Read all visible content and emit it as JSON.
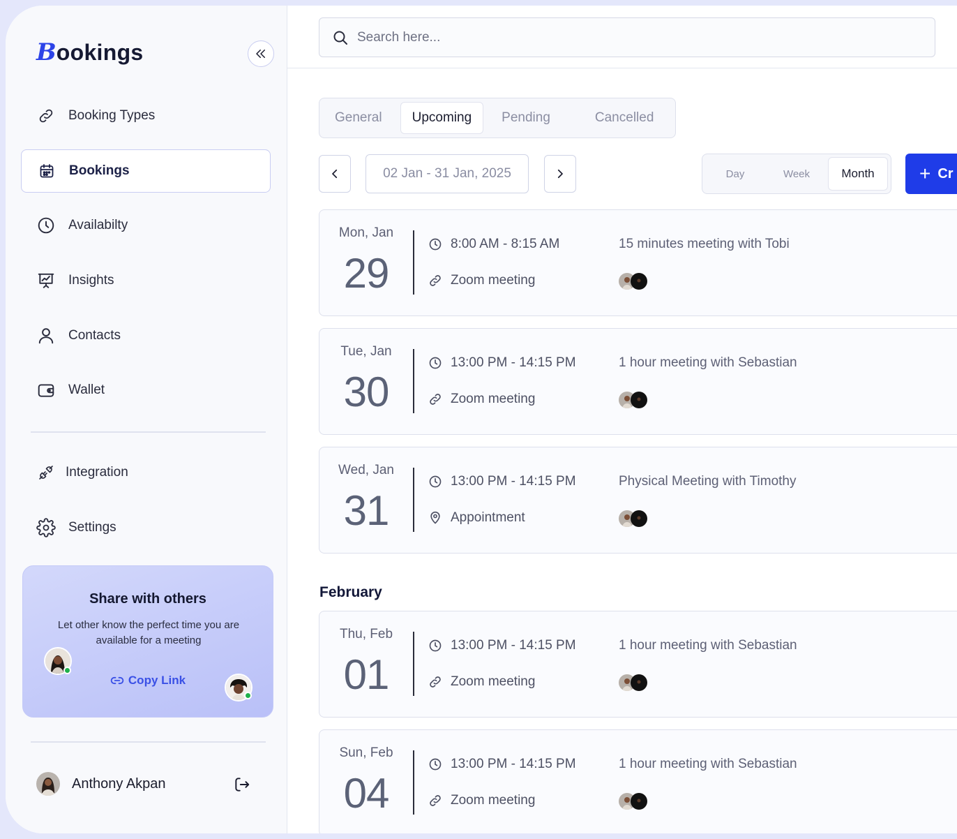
{
  "app": {
    "logo_initial": "B",
    "logo_rest": "ookings"
  },
  "sidebar": {
    "items": [
      {
        "label": "Booking Types",
        "icon": "link-icon"
      },
      {
        "label": "Bookings",
        "icon": "calendar-icon",
        "active": true
      },
      {
        "label": "Availabilty",
        "icon": "clock-icon"
      },
      {
        "label": "Insights",
        "icon": "presentation-chart-icon"
      },
      {
        "label": "Contacts",
        "icon": "user-icon"
      },
      {
        "label": "Wallet",
        "icon": "wallet-icon"
      }
    ],
    "secondary_items": [
      {
        "label": "Integration",
        "icon": "plug-icon"
      },
      {
        "label": "Settings",
        "icon": "gear-icon"
      }
    ],
    "share_card": {
      "title": "Share with others",
      "description": "Let other know the perfect time you are available for a meeting",
      "copy_link_label": "Copy Link"
    },
    "user": {
      "name": "Anthony Akpan"
    }
  },
  "search": {
    "placeholder": "Search here..."
  },
  "tabs": [
    {
      "label": "General"
    },
    {
      "label": "Upcoming",
      "active": true
    },
    {
      "label": "Pending"
    },
    {
      "label": "Cancelled"
    }
  ],
  "date_nav": {
    "range": "02 Jan - 31 Jan, 2025"
  },
  "view_toggle": [
    {
      "label": "Day"
    },
    {
      "label": "Week"
    },
    {
      "label": "Month",
      "active": true
    }
  ],
  "create_button": {
    "label": "Cr"
  },
  "events": [
    {
      "day": "Mon, Jan",
      "date": "29",
      "time": "8:00 AM - 8:15 AM",
      "location": "Zoom meeting",
      "location_icon": "link-icon",
      "title": "15 minutes meeting with Tobi"
    },
    {
      "day": "Tue, Jan",
      "date": "30",
      "time": "13:00 PM - 14:15 PM",
      "location": "Zoom meeting",
      "location_icon": "link-icon",
      "title": "1 hour meeting with Sebastian"
    },
    {
      "day": "Wed, Jan",
      "date": "31",
      "time": "13:00 PM - 14:15 PM",
      "location": "Appointment",
      "location_icon": "map-pin-icon",
      "title": "Physical Meeting with Timothy"
    }
  ],
  "february": {
    "heading": "February",
    "events": [
      {
        "day": "Thu, Feb",
        "date": "01",
        "time": "13:00 PM - 14:15 PM",
        "location": "Zoom meeting",
        "location_icon": "link-icon",
        "title": "1 hour meeting with Sebastian"
      },
      {
        "day": "Sun, Feb",
        "date": "04",
        "time": "13:00 PM - 14:15 PM",
        "location": "Zoom meeting",
        "location_icon": "link-icon",
        "title": "1 hour meeting with Sebastian"
      }
    ]
  },
  "colors": {
    "brand": "#1f3ce8",
    "active_border": "#c9cdf2",
    "online": "#1fb04c"
  }
}
